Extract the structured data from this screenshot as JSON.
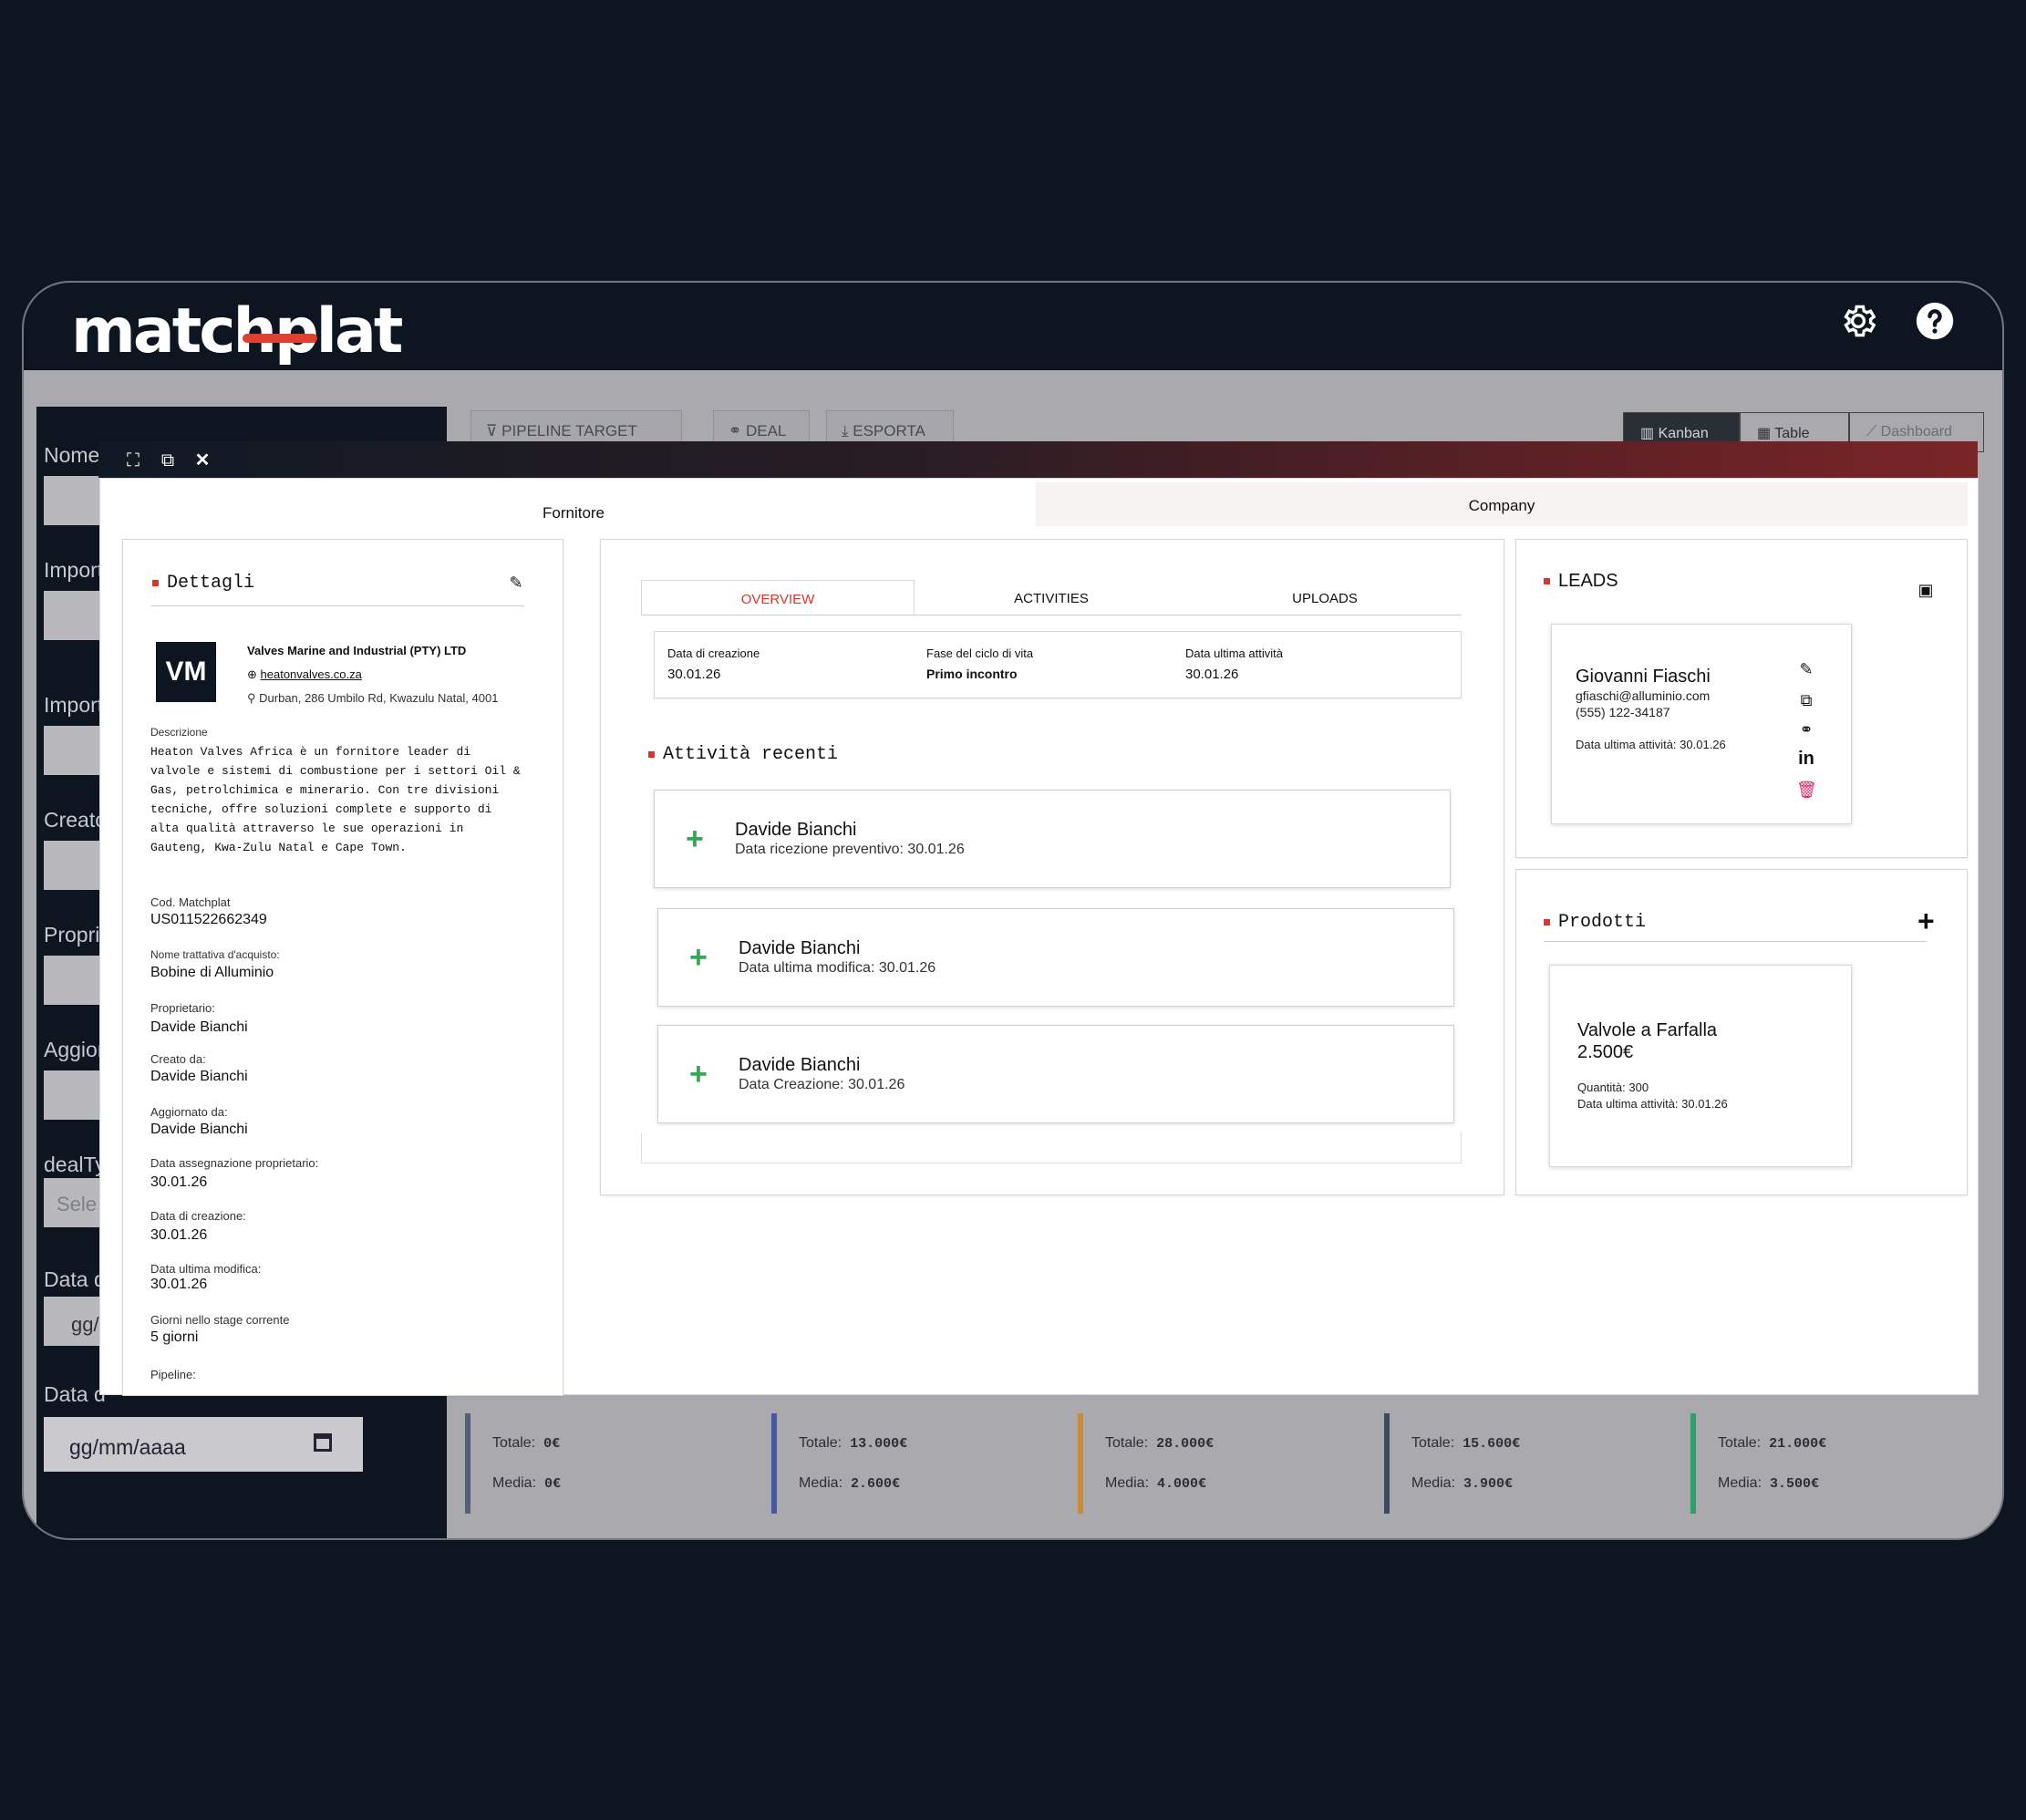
{
  "app": {
    "brand": "matchplat"
  },
  "filters": {
    "labels": [
      "Nome",
      "Import",
      "Import",
      "Creato",
      "Propri",
      "Aggior",
      "dealTy",
      "Data d",
      "Data d"
    ],
    "select_placeholder": "Sele",
    "date_partial": "gg/",
    "date_placeholder": "gg/mm/aaaa"
  },
  "toolbar": {
    "pipeline_target": "PIPELINE TARGET",
    "deal": "DEAL",
    "esporta": "ESPORTA",
    "views": {
      "kanban": "Kanban",
      "table": "Table",
      "dashboard": "Dashboard"
    }
  },
  "kanban_stats": [
    {
      "totale_label": "Totale:",
      "totale": "0€",
      "media_label": "Media:",
      "media": "0€",
      "color": "#54607a"
    },
    {
      "totale_label": "Totale:",
      "totale": "13.000€",
      "media_label": "Media:",
      "media": "2.600€",
      "color": "#4657a8"
    },
    {
      "totale_label": "Totale:",
      "totale": "28.000€",
      "media_label": "Media:",
      "media": "4.000€",
      "color": "#c98a3a"
    },
    {
      "totale_label": "Totale:",
      "totale": "15.600€",
      "media_label": "Media:",
      "media": "3.900€",
      "color": "#3c4a60"
    },
    {
      "totale_label": "Totale:",
      "totale": "21.000€",
      "media_label": "Media:",
      "media": "3.500€",
      "color": "#2f9e6a"
    }
  ],
  "modal": {
    "tabs": {
      "fornitore": "Fornitore",
      "company": "Company"
    },
    "details": {
      "title": "Dettagli",
      "initials": "VM",
      "company_name": "Valves Marine and Industrial (PTY) LTD",
      "website": "heatonvalves.co.za",
      "address": "Durban, 286 Umbilo Rd, Kwazulu Natal, 4001",
      "description_label": "Descrizione",
      "description_lines": [
        "Heaton Valves Africa è un fornitore leader di",
        "valvole e sistemi di combustione per i settori Oil &",
        "Gas, petrolchimica e minerario. Con tre divisioni",
        "tecniche, offre soluzioni complete e supporto di",
        "alta qualità attraverso le sue operazioni in",
        "Gauteng, Kwa-Zulu Natal e Cape Town."
      ],
      "fields": [
        {
          "label": "Cod. Matchplat",
          "value": "US011522662349"
        },
        {
          "label": "Nome trattativa d'acquisto:",
          "value": "Bobine di Alluminio"
        },
        {
          "label": "Proprietario:",
          "value": "Davide Bianchi"
        },
        {
          "label": "Creato da:",
          "value": "Davide Bianchi"
        },
        {
          "label": "Aggiornato da:",
          "value": "Davide Bianchi"
        },
        {
          "label": "Data assegnazione proprietario:",
          "value": "30.01.26"
        },
        {
          "label": "Data di creazione:",
          "value": "30.01.26"
        },
        {
          "label": "Data ultima modifica:",
          "value": "30.01.26"
        },
        {
          "label": "Giorni nello stage corrente",
          "value": "5 giorni"
        },
        {
          "label": "Pipeline:",
          "value": ""
        }
      ]
    },
    "overview": {
      "tabs": {
        "overview": "OVERVIEW",
        "activities": "ACTIVITIES",
        "uploads": "UPLOADS"
      },
      "summary": [
        {
          "label": "Data di creazione",
          "value": "30.01.26"
        },
        {
          "label": "Fase del ciclo di vita",
          "value": "Primo incontro"
        },
        {
          "label": "Data ultima attività",
          "value": "30.01.26"
        }
      ],
      "recent_title": "Attività recenti",
      "activities": [
        {
          "name": "Davide Bianchi",
          "detail": "Data ricezione preventivo: 30.01.26"
        },
        {
          "name": "Davide Bianchi",
          "detail": "Data ultima modifica: 30.01.26"
        },
        {
          "name": "Davide Bianchi",
          "detail": "Data Creazione: 30.01.26"
        }
      ]
    },
    "leads": {
      "title": "LEADS",
      "name": "Giovanni Fiaschi",
      "email": "gfiaschi@alluminio.com",
      "phone": "(555) 122-34187",
      "last_activity": "Data ultima attività: 30.01.26",
      "linkedin": "in"
    },
    "products": {
      "title": "Prodotti",
      "name": "Valvole a Farfalla",
      "price": "2.500€",
      "quantity": "Quantità: 300",
      "last_activity": "Data ultima attività: 30.01.26"
    }
  }
}
